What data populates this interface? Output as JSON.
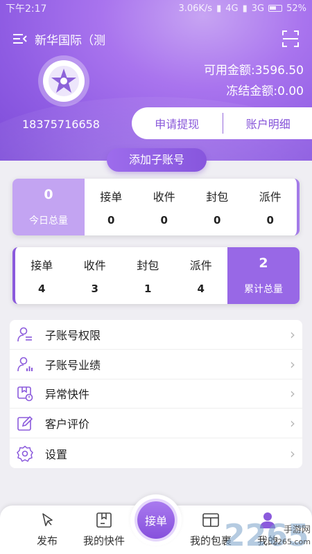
{
  "status_bar": {
    "time": "下午2:17",
    "net_speed": "3.06K/s",
    "network1": "4G",
    "network2": "3G",
    "battery": "52%"
  },
  "header": {
    "title": "新华国际（测",
    "phone": "18375716658",
    "available_balance": "可用金额:3596.50",
    "frozen_balance": "冻结金额:0.00",
    "withdraw_label": "申请提现",
    "account_detail_label": "账户明细"
  },
  "add_sub_account_label": "添加子账号",
  "today_stats": {
    "highlight": {
      "value": "0",
      "label": "今日总量"
    },
    "items": [
      {
        "label": "接单",
        "value": "0"
      },
      {
        "label": "收件",
        "value": "0"
      },
      {
        "label": "封包",
        "value": "0"
      },
      {
        "label": "派件",
        "value": "0"
      }
    ]
  },
  "total_stats": {
    "items": [
      {
        "label": "接单",
        "value": "4"
      },
      {
        "label": "收件",
        "value": "3"
      },
      {
        "label": "封包",
        "value": "1"
      },
      {
        "label": "派件",
        "value": "4"
      }
    ],
    "highlight": {
      "value": "2",
      "label": "累计总量"
    }
  },
  "menu": [
    {
      "label": "子账号权限",
      "icon": "user-permission-icon"
    },
    {
      "label": "子账号业绩",
      "icon": "user-performance-icon"
    },
    {
      "label": "异常快件",
      "icon": "abnormal-package-icon"
    },
    {
      "label": "客户评价",
      "icon": "edit-review-icon"
    },
    {
      "label": "设置",
      "icon": "gear-icon"
    }
  ],
  "bottom_nav": {
    "publish": "发布",
    "my_packages": "我的快件",
    "accept_order": "接单",
    "my_parcels": "我的包裹",
    "mine": "我的"
  },
  "watermark": {
    "brand": "2265",
    "site": "手游网",
    "url": "2265.com"
  },
  "colors": {
    "accent": "#8b5adc",
    "accent_light": "#c3a4f2"
  }
}
